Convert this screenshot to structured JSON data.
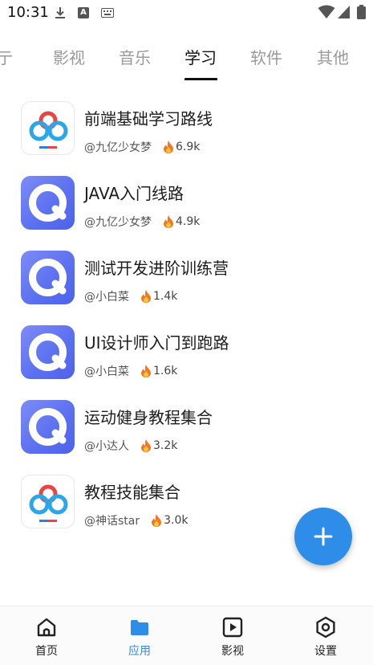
{
  "status_bar": {
    "time": "10:31",
    "icons": [
      "download-icon",
      "a-notification-icon",
      "keyboard-icon",
      "wifi-icon",
      "signal-icon",
      "battery-icon"
    ]
  },
  "tabs": {
    "items": [
      {
        "label": "亍",
        "active": false
      },
      {
        "label": "影视",
        "active": false
      },
      {
        "label": "音乐",
        "active": false
      },
      {
        "label": "学习",
        "active": true
      },
      {
        "label": "软件",
        "active": false
      },
      {
        "label": "其他",
        "active": false
      }
    ]
  },
  "list": {
    "items": [
      {
        "title": "前端基础学习路线",
        "author": "@九亿少女梦",
        "heat": "6.9k",
        "icon": "baidu-cloud-icon"
      },
      {
        "title": "JAVA入门线路",
        "author": "@九亿少女梦",
        "heat": "4.9k",
        "icon": "quark-icon"
      },
      {
        "title": "测试开发进阶训练营",
        "author": "@小白菜",
        "heat": "1.4k",
        "icon": "quark-icon"
      },
      {
        "title": "UI设计师入门到跑路",
        "author": "@小白菜",
        "heat": "1.6k",
        "icon": "quark-icon"
      },
      {
        "title": "运动健身教程集合",
        "author": "@小达人",
        "heat": "3.2k",
        "icon": "quark-icon"
      },
      {
        "title": "教程技能集合",
        "author": "@神话star",
        "heat": "3.0k",
        "icon": "baidu-cloud-icon"
      }
    ]
  },
  "fab": {
    "icon": "plus-icon",
    "color": "#2d8de8"
  },
  "bottom_nav": {
    "items": [
      {
        "label": "首页",
        "icon": "home-icon",
        "active": false
      },
      {
        "label": "应用",
        "icon": "folder-icon",
        "active": true
      },
      {
        "label": "影视",
        "icon": "play-icon",
        "active": false
      },
      {
        "label": "设置",
        "icon": "settings-icon",
        "active": false
      }
    ]
  },
  "colors": {
    "accent": "#2d8de8",
    "fire": "#f07a22",
    "active_tab": "#111111",
    "inactive_tab": "#9a9a9a"
  }
}
